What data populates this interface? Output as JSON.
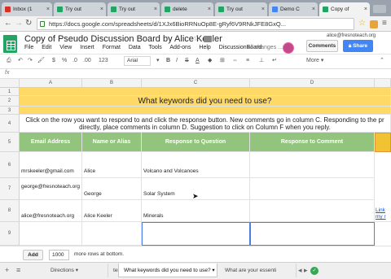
{
  "browser": {
    "tabs": [
      {
        "label": "Inbox (1",
        "color": "#d93025"
      },
      {
        "label": "Try out",
        "color": "#21a464"
      },
      {
        "label": "Try out",
        "color": "#21a464"
      },
      {
        "label": "delete",
        "color": "#21a464"
      },
      {
        "label": "Try out",
        "color": "#21a464"
      },
      {
        "label": "Demo C",
        "color": "#4285f4"
      },
      {
        "label": "Copy of",
        "color": "#21a464"
      }
    ],
    "url": "https://docs.google.com/spreadsheets/d/1XJx6BioRRNuOp8E-gRyf6V9RNkJFE8GxQ..."
  },
  "sheet": {
    "title": "Copy of Pseudo Discussion Board by Alice Keeler",
    "user_email": "alice@fresnoteach.org",
    "menu": [
      "File",
      "Edit",
      "View",
      "Insert",
      "Format",
      "Data",
      "Tools",
      "Add-ons",
      "Help",
      "DiscussionBoard"
    ],
    "save_status": "All changes ...",
    "comments_label": "Comments",
    "share_label": "Share",
    "toolbar": {
      "zoom_pct": "%",
      "dec1": ".0",
      "dec2": ".00",
      "numfmt": "123",
      "font": "Arial",
      "more": "More"
    },
    "fx": "fx",
    "columns": [
      "A",
      "B",
      "C",
      "D"
    ],
    "rows": {
      "r1": "1",
      "r2": "2",
      "r3": "3",
      "r4": "4",
      "r5": "5",
      "r6": "6",
      "r7": "7",
      "r8": "8",
      "r9": "9"
    },
    "heading": "What keywords did you need to use?",
    "instructions": "Click on the row you want to respond to and click the response button. New comments go in column C. Responding to the pr directly, place comments in column D. Suggestion to click on Column F when you reply.",
    "headers": {
      "email": "Email Address",
      "name": "Name or Alias",
      "resp_q": "Response to Question",
      "resp_c": "Response to Comment"
    },
    "data": [
      {
        "email": "mrskeeler@gmail.com",
        "name": "Alice",
        "response": "Volcano and Volcanoes"
      },
      {
        "email": "george@fresnoteach.org",
        "name": "George",
        "response": "Solar System"
      },
      {
        "email": "alice@fresnoteach.org",
        "name": "Alice Keeler",
        "response": "Minerals"
      }
    ],
    "link_text": "Link my r",
    "add_label": "Add",
    "add_rows_value": "1000",
    "add_rows_suffix": "more rows at bottom.",
    "sheet_tabs": [
      "Directions",
      "template",
      "What keywords did you need to use?",
      "What are your essenti"
    ]
  },
  "colors": {
    "header_yellow": "#ffd966",
    "header_green": "#93c47d",
    "share_blue": "#4285f4",
    "sheets_green": "#21a464"
  }
}
